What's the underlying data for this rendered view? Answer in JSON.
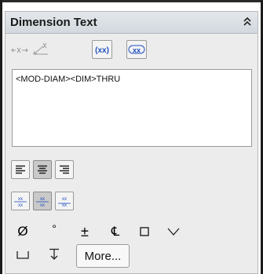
{
  "panel": {
    "title": "Dimension Text"
  },
  "text": {
    "value": "<MOD-DIAM><DIM>THRU"
  },
  "buttons": {
    "more_label": "More...",
    "paren_glyph_1": "xx",
    "paren_glyph_2": "xx"
  },
  "icons": {
    "collapse": "double-chevron-up-icon",
    "diameter": "diameter-icon",
    "degree": "degree-icon",
    "plus_minus": "plus-minus-icon",
    "centerline": "centerline-icon",
    "square": "square-icon",
    "countersink": "countersink-icon",
    "counterbore": "counterbore-icon",
    "depth": "depth-icon"
  },
  "symbols": {
    "diameter": "Ø",
    "degree": "°",
    "plus_minus": "±",
    "centerline": "℄"
  },
  "colors": {
    "accent_blue": "#1f4fbf",
    "header_bg": "#d8dde2"
  }
}
